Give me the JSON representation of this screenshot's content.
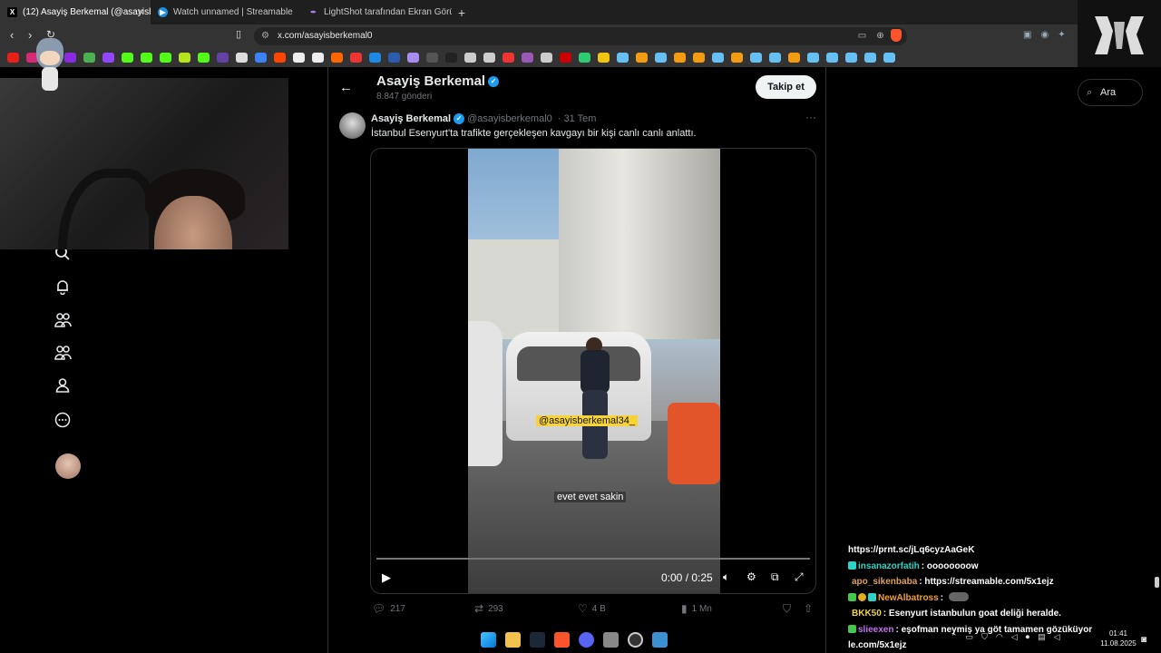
{
  "browser": {
    "tabs": [
      {
        "label": "(12) Asayiş Berkemal (@asayisbe",
        "active": true,
        "favicon": "x-icon"
      },
      {
        "label": "Watch unnamed | Streamable",
        "active": false,
        "favicon": "streamable-icon"
      },
      {
        "label": "LightShot tarafından Ekran Görüntüs",
        "active": false,
        "favicon": "lightshot-icon"
      }
    ],
    "url": "x.com/asayisberkemal0"
  },
  "profile_header": {
    "name": "Asayiş Berkemal",
    "post_count": "8.847 gönderi",
    "follow_label": "Takip et"
  },
  "post": {
    "author": "Asayiş Berkemal",
    "handle": "@asayisberkemal0",
    "date": "· 31 Tem",
    "text": "İstanbul Esenyurt'ta trafikte gerçekleşen kavgayı bir kişi canlı canlı anlattı.",
    "video": {
      "caption_watermark": "@asayisberkemal34_",
      "caption_subtitle": "evet evet sakin",
      "time": "0:00 / 0:25",
      "progress": 0
    },
    "stats": {
      "replies": "217",
      "reposts": "293",
      "likes": "4 B",
      "views": "1 Mn"
    }
  },
  "search": {
    "placeholder": "Ara"
  },
  "chat": [
    {
      "user": "",
      "message": "https://prnt.sc/jLq6cyzAaGeK",
      "color": "#ffffff"
    },
    {
      "user": "insanazorfatih",
      "message": ": oooooooow",
      "color": "#2ad4c8"
    },
    {
      "user": "apo_sikenbaba",
      "message": ": https://streamable.com/5x1ejz",
      "color": "#e0a060"
    },
    {
      "user": "NewAlbatross",
      "message": ":",
      "color": "#f0a030"
    },
    {
      "user": "BKK50",
      "message": ": Esenyurt istanbulun goat deliği heralde.",
      "color": "#f0d040"
    },
    {
      "user": "slieexen",
      "message": ": eşofman neymiş ya göt tamamen gözüküyor",
      "color": "#c070f0"
    },
    {
      "user": "",
      "message": "le.com/5x1ejz",
      "color": "#ffffff"
    }
  ],
  "system": {
    "time": "01:41",
    "date": "11.08.2025"
  },
  "colors": {
    "accent": "#1d9bf0",
    "background": "#000000",
    "muted": "#71767b"
  }
}
